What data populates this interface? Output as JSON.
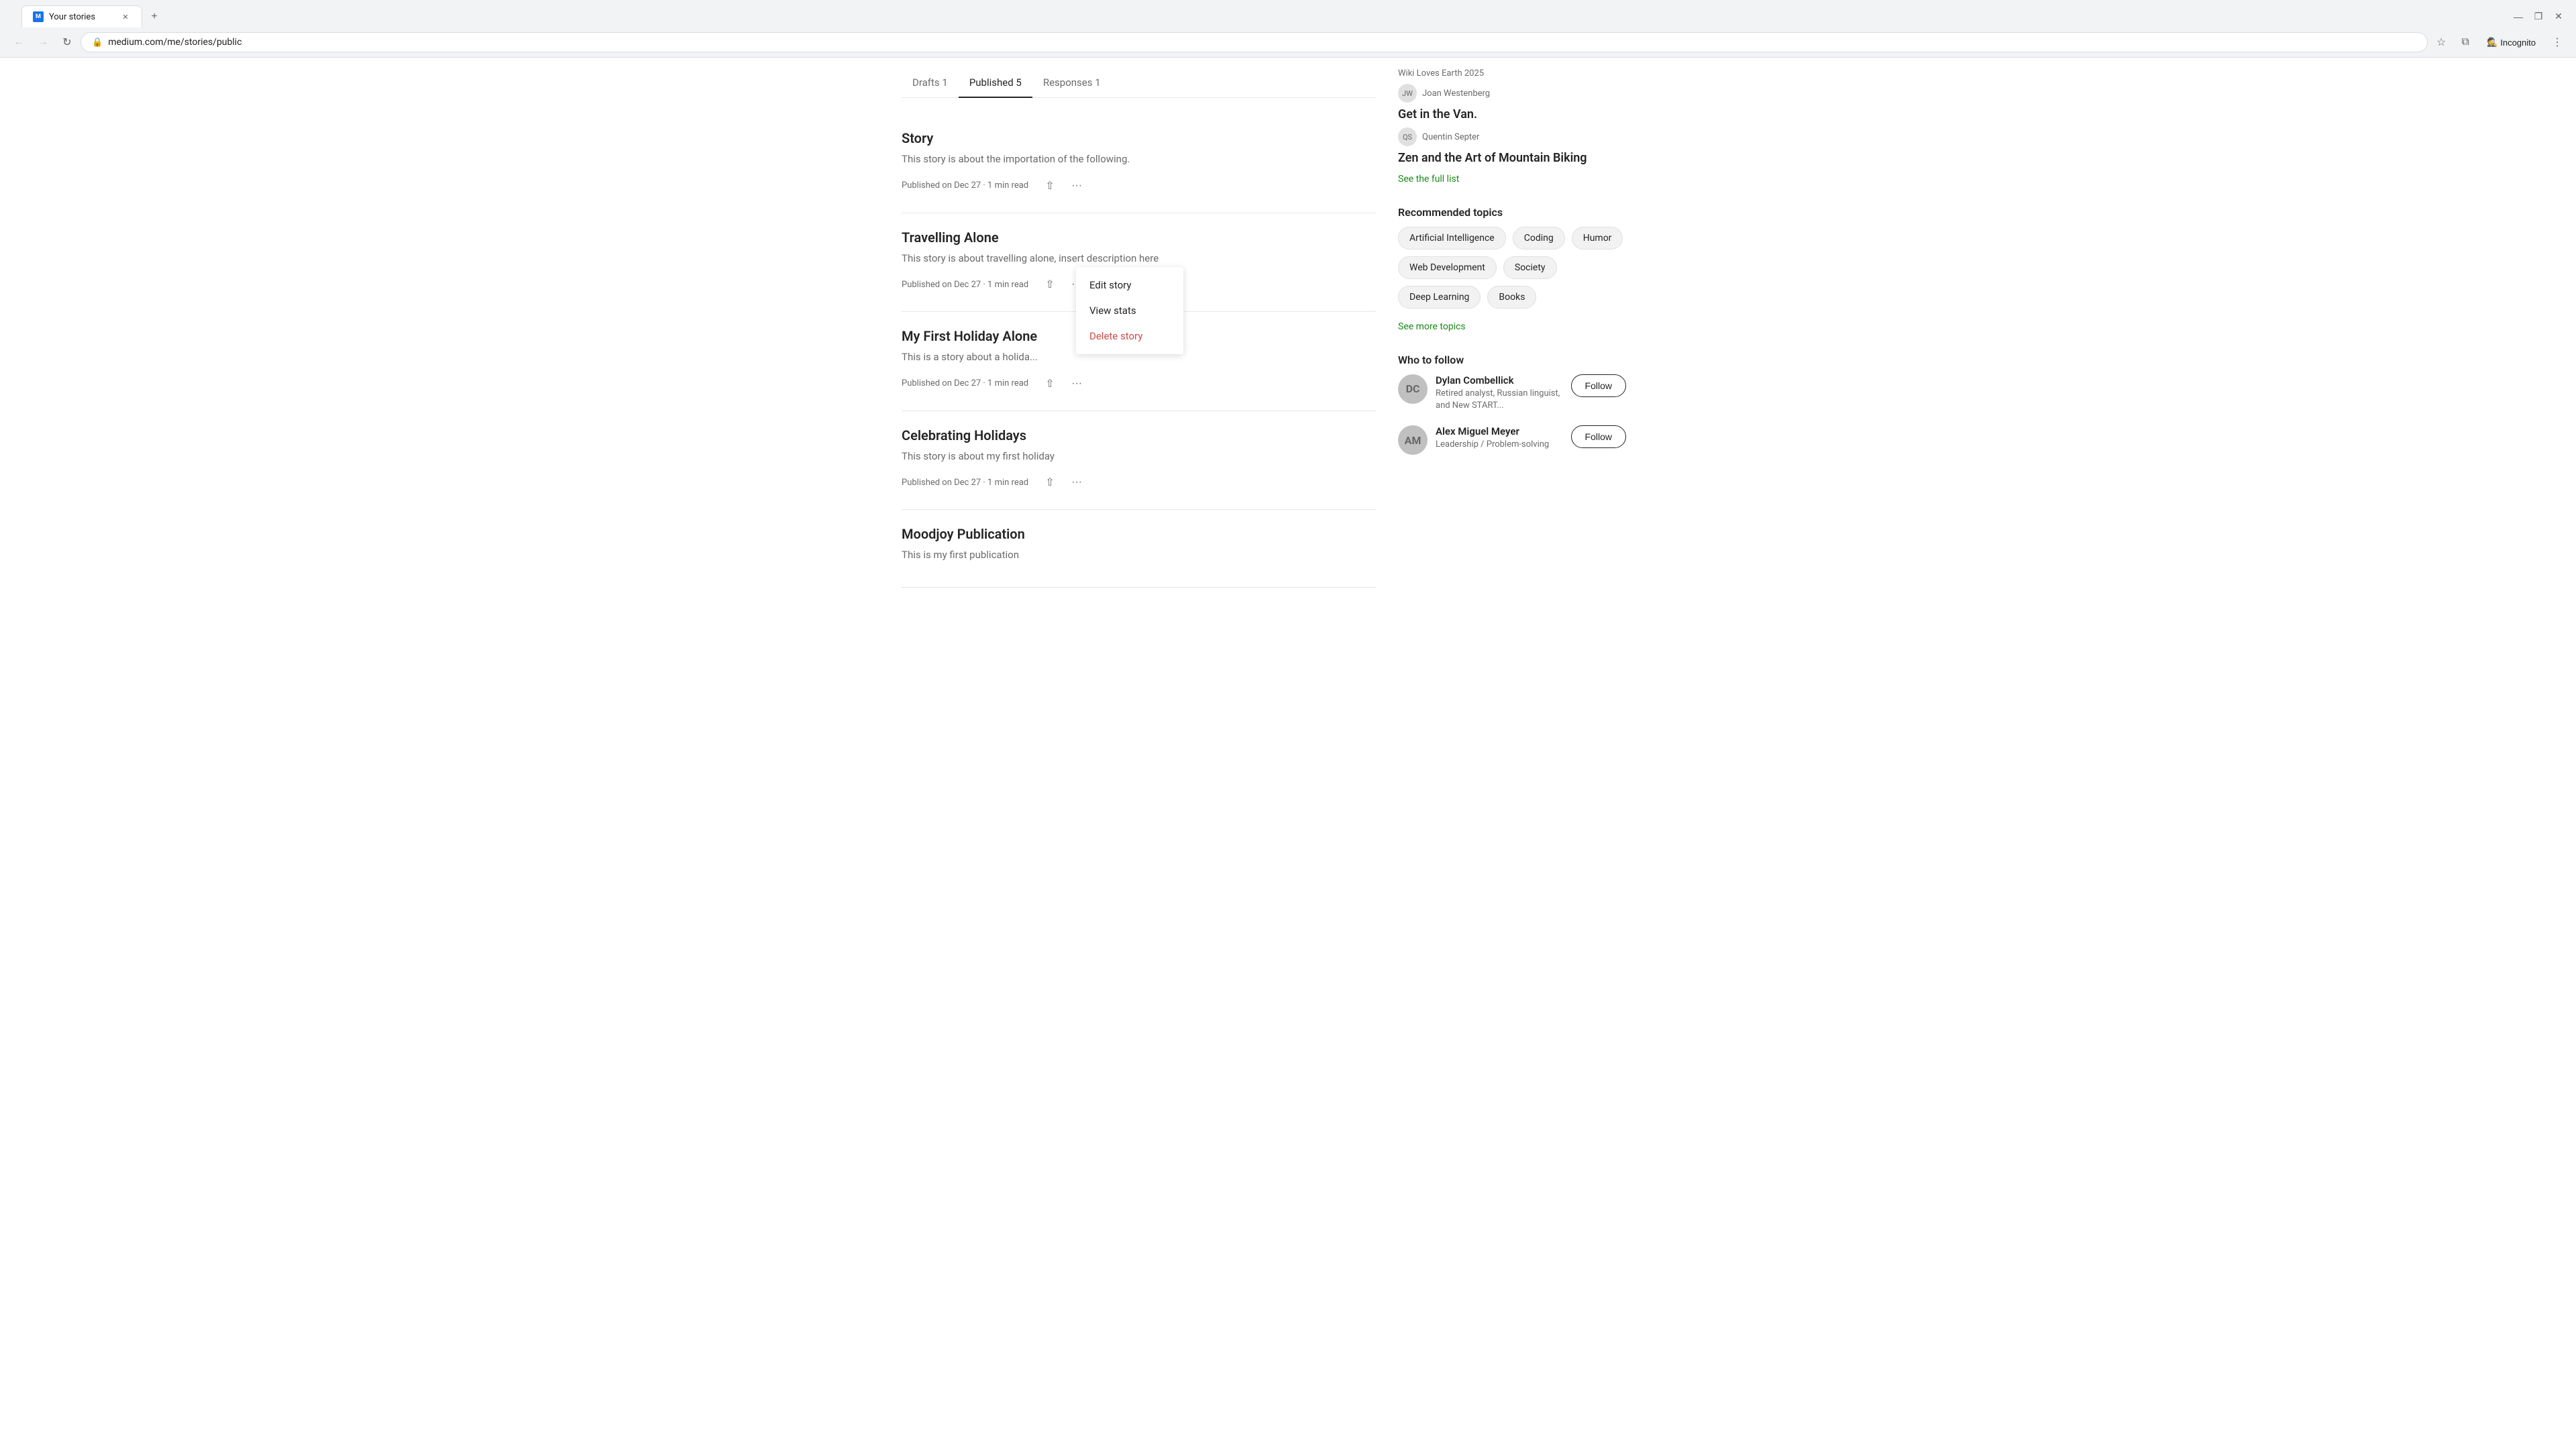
{
  "browser": {
    "tab_title": "Your stories",
    "url": "medium.com/me/stories/public",
    "new_tab_label": "+",
    "back_btn": "←",
    "forward_btn": "→",
    "reload_btn": "↻",
    "profile_label": "Incognito",
    "window_minimize": "—",
    "window_maximize": "❐",
    "window_close": "✕"
  },
  "page": {
    "tabs": [
      {
        "label": "Drafts 1",
        "active": false
      },
      {
        "label": "Published 5",
        "active": true
      },
      {
        "label": "Responses 1",
        "active": false
      }
    ],
    "stories": [
      {
        "id": "story",
        "title": "Story",
        "description": "This story is about the importation of the following.",
        "meta": "Published on Dec 27 · 1 min read",
        "has_dropdown": false
      },
      {
        "id": "travelling-alone",
        "title": "Travelling Alone",
        "description": "This story is about travelling alone, insert description here",
        "meta": "Published on Dec 27 · 1 min read",
        "has_dropdown": true
      },
      {
        "id": "my-first-holiday",
        "title": "My First Holiday Alone",
        "description": "This is a story about a holida...",
        "meta": "Published on Dec 27 · 1 min read",
        "has_dropdown": false
      },
      {
        "id": "celebrating-holidays",
        "title": "Celebrating Holidays",
        "description": "This story is about my first holiday",
        "meta": "Published on Dec 27 · 1 min read",
        "has_dropdown": false
      },
      {
        "id": "moodjoy-publication",
        "title": "Moodjoy Publication",
        "description": "This is my first publication",
        "meta": "",
        "has_dropdown": false
      }
    ],
    "dropdown": {
      "edit_label": "Edit story",
      "stats_label": "View stats",
      "delete_label": "Delete story"
    }
  },
  "sidebar": {
    "wiki_loves": {
      "title": "Wiki Loves Earth 2025"
    },
    "featured_author": {
      "name": "Joan Westenberg",
      "story_title": "Get in the Van."
    },
    "recommended_story": {
      "author_name": "Quentin Septer",
      "story_title": "Zen and the Art of Mountain Biking",
      "see_full_list": "See the full list"
    },
    "recommended_topics": {
      "title": "Recommended topics",
      "topics": [
        "Artificial Intelligence",
        "Coding",
        "Humor",
        "Web Development",
        "Society",
        "Deep Learning",
        "Books"
      ],
      "see_more": "See more topics"
    },
    "who_to_follow": {
      "title": "Who to follow",
      "people": [
        {
          "name": "Dylan Combellick",
          "bio": "Retired analyst, Russian linguist, and New START...",
          "follow_label": "Follow"
        },
        {
          "name": "Alex Miguel Meyer",
          "bio": "Leadership / Problem-solving",
          "follow_label": "Follow"
        }
      ]
    }
  }
}
